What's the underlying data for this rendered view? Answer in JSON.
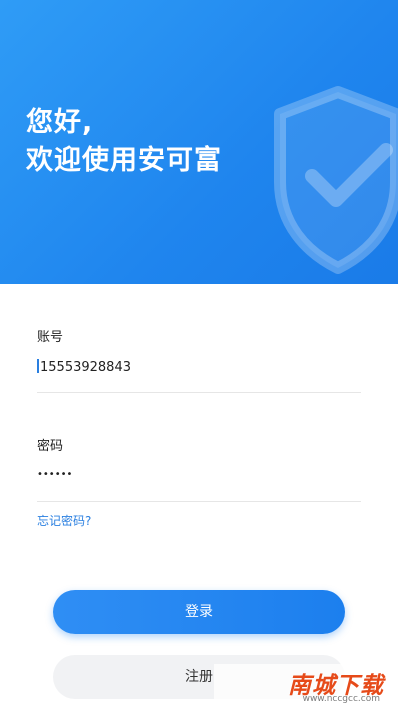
{
  "header": {
    "greeting_line1": "您好,",
    "greeting_line2": "欢迎使用安可富"
  },
  "form": {
    "account_label": "账号",
    "account_value": "15553928843",
    "password_label": "密码",
    "password_value": "••••••",
    "forgot_label": "忘记密码?"
  },
  "buttons": {
    "login_label": "登录",
    "register_label": "注册"
  },
  "watermark": {
    "brand": "南城下载",
    "url": "www.nccgcc.com"
  },
  "colors": {
    "primary": "#1f85ee",
    "link": "#2a7fe0"
  },
  "icons": [
    "shield-check-icon"
  ]
}
